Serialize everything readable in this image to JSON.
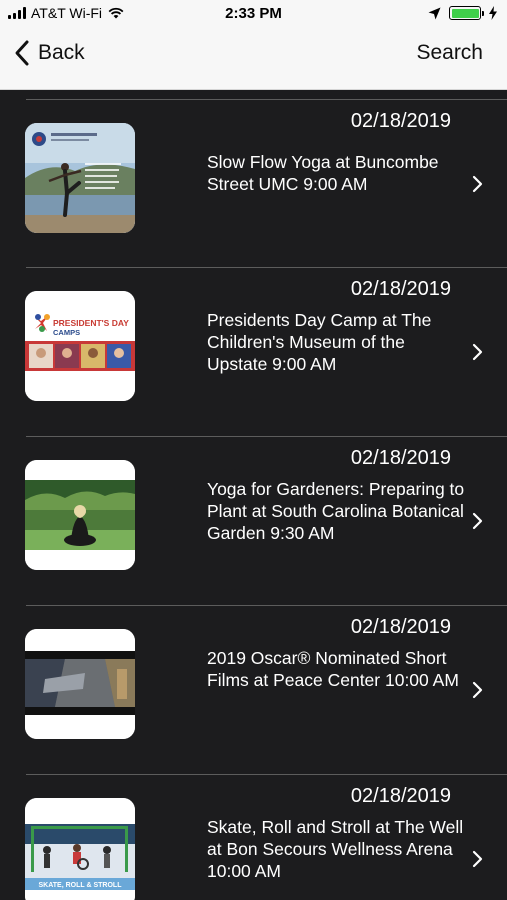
{
  "status_bar": {
    "carrier": "AT&T Wi-Fi",
    "time": "2:33 PM",
    "icons": [
      "signal-icon",
      "wifi-icon",
      "location-arrow-icon",
      "battery-icon",
      "charging-bolt-icon"
    ],
    "battery_color": "#3fcf4a"
  },
  "nav": {
    "back_label": "Back",
    "search_label": "Search"
  },
  "events": [
    {
      "date": "02/18/2019",
      "title": "Slow Flow Yoga at Buncombe Street UMC 9:00 AM"
    },
    {
      "date": "02/18/2019",
      "title": "Presidents Day Camp at The Children's Museum of the Upstate 9:00 AM",
      "thumb_text": "PRESIDENT'S DAY",
      "thumb_subtext": "CAMPS"
    },
    {
      "date": "02/18/2019",
      "title": "Yoga for Gardeners: Preparing to Plant at South Carolina Botanical Garden 9:30 AM"
    },
    {
      "date": "02/18/2019",
      "title": "2019 Oscar® Nominated Short Films at Peace Center 10:00 AM"
    },
    {
      "date": "02/18/2019",
      "title": "Skate, Roll and Stroll at The Well at Bon Secours Wellness Arena 10:00 AM",
      "thumb_text": "SKATE, ROLL & STROLL"
    }
  ],
  "colors": {
    "list_background": "#1c1c1e",
    "text": "#ffffff",
    "divider": "#5c5c5c"
  }
}
